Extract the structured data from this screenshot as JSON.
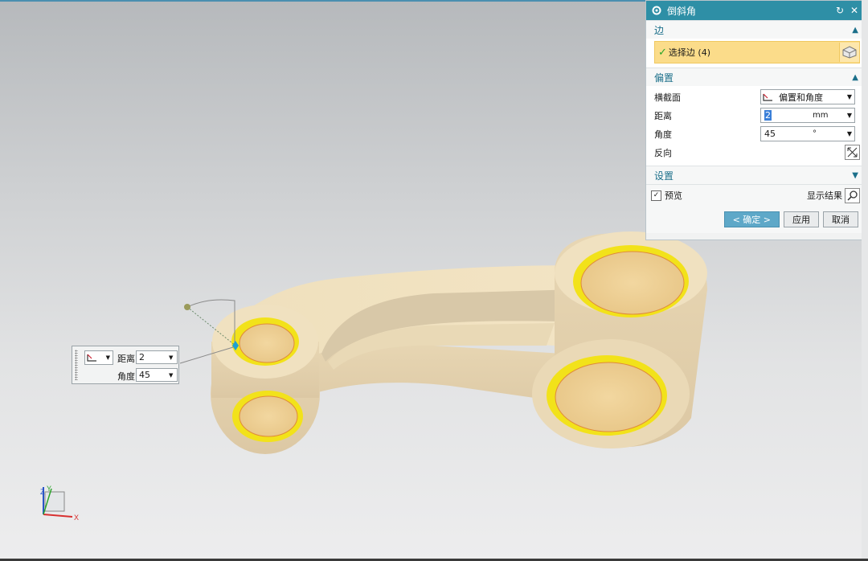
{
  "dialog": {
    "title": "倒斜角",
    "sections": {
      "edge": {
        "title": "边",
        "select_label": "选择边 (4)"
      },
      "offset": {
        "title": "偏置",
        "cross_section_label": "横截面",
        "cross_section_value": "偏置和角度",
        "distance_label": "距离",
        "distance_value": "2",
        "distance_unit": "mm",
        "angle_label": "角度",
        "angle_value": "45",
        "angle_unit": "°",
        "reverse_label": "反向"
      },
      "settings": {
        "title": "设置"
      }
    },
    "preview_label": "预览",
    "show_result_label": "显示结果",
    "ok_label": "< 确定 >",
    "apply_label": "应用",
    "cancel_label": "取消"
  },
  "float_input": {
    "distance_label": "距离",
    "distance_value": "2",
    "angle_label": "角度",
    "angle_value": "45"
  },
  "triad": {
    "x": "X",
    "y": "Y",
    "z": "Z"
  },
  "colors": {
    "accent": "#2e8fa6",
    "part": "#ecdcb8",
    "highlight_edge": "#f2e21a",
    "selection_bar": "#fbdc8a"
  }
}
